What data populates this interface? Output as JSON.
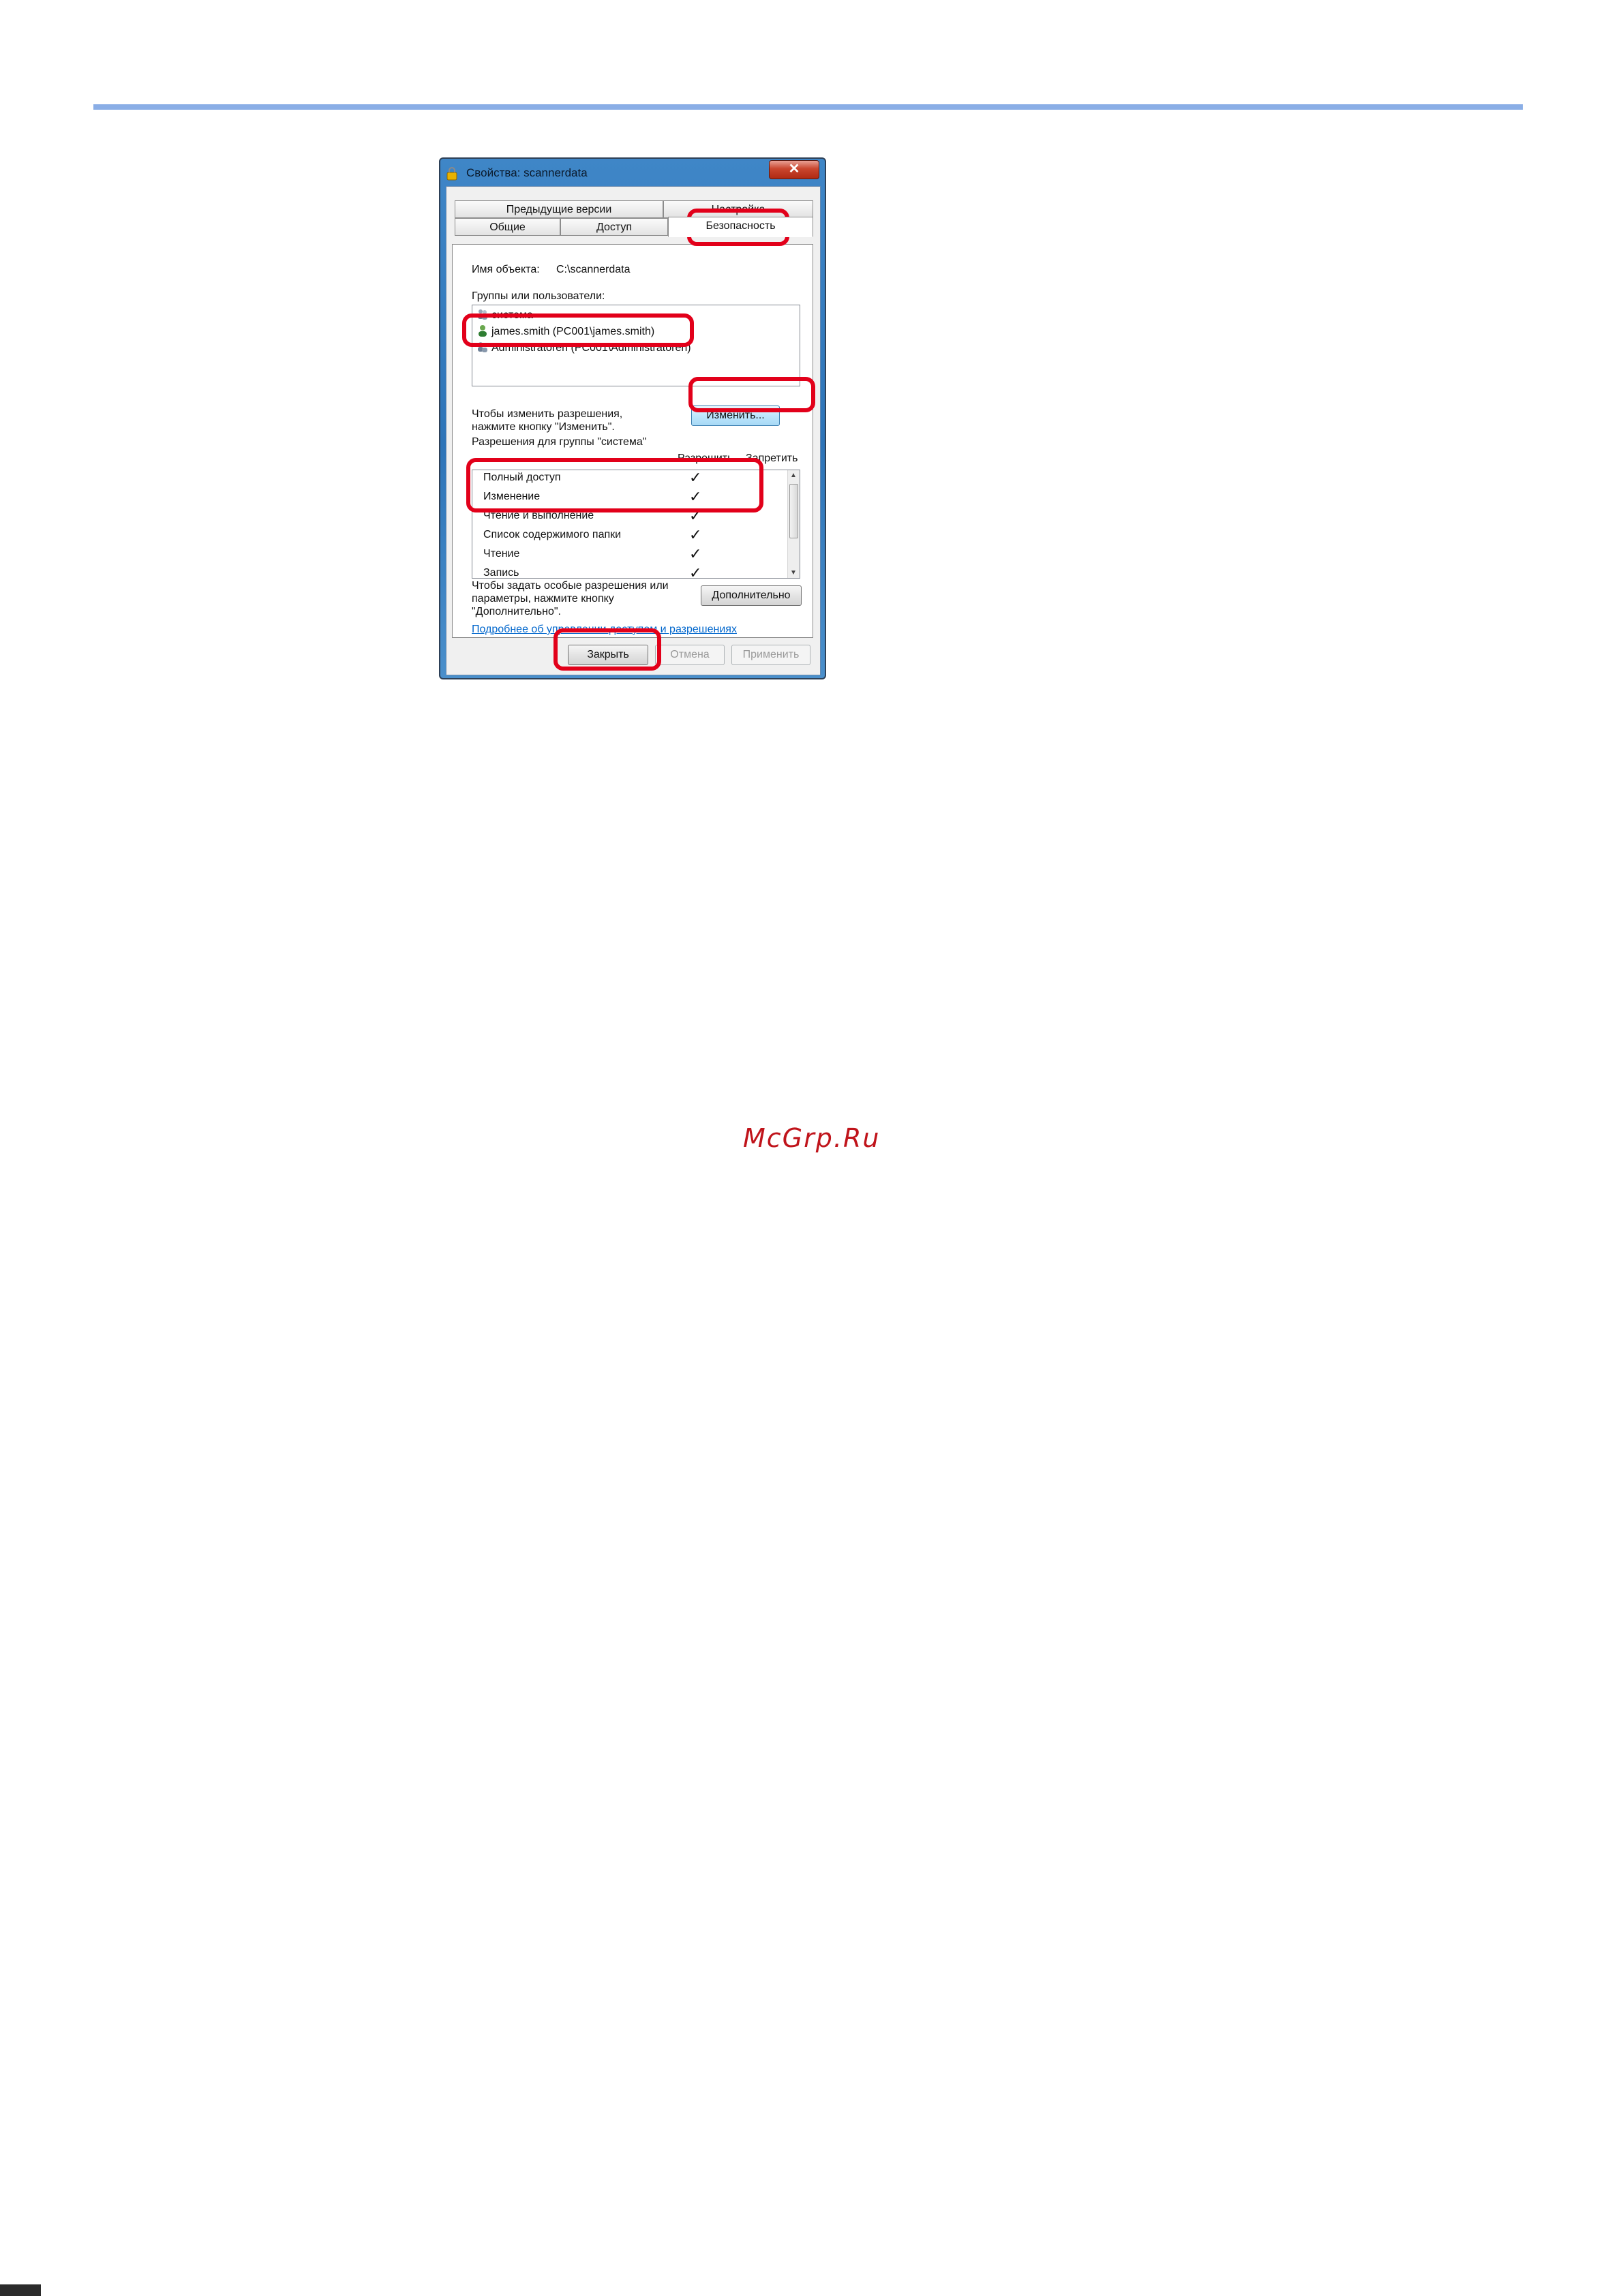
{
  "window": {
    "title": "Свойства: scannerdata",
    "close_glyph": "✕"
  },
  "tabs": {
    "row1": [
      "Предыдущие версии",
      "Настройка"
    ],
    "row2": [
      "Общие",
      "Доступ",
      "Безопасность"
    ],
    "active": "Безопасность"
  },
  "security": {
    "object_name_label": "Имя объекта:",
    "object_name_value": "C:\\scannerdata",
    "groups_label": "Группы или пользователи:",
    "groups": [
      "система",
      "james.smith (PC001\\james.smith)",
      "Administratoren (PC001\\Administratoren)"
    ],
    "change_hint_line1": "Чтобы изменить разрешения,",
    "change_hint_line2": "нажмите кнопку \"Изменить\".",
    "change_button": "Изменить...",
    "permissions_for_label": "Разрешения для группы \"система\"",
    "col_allow": "Разрешить",
    "col_deny": "Запретить",
    "permissions": [
      {
        "name": "Полный доступ",
        "allow": true,
        "deny": false
      },
      {
        "name": "Изменение",
        "allow": true,
        "deny": false
      },
      {
        "name": "Чтение и выполнение",
        "allow": true,
        "deny": false
      },
      {
        "name": "Список содержимого папки",
        "allow": true,
        "deny": false
      },
      {
        "name": "Чтение",
        "allow": true,
        "deny": false
      },
      {
        "name": "Запись",
        "allow": true,
        "deny": false
      }
    ],
    "check_glyph": "✓",
    "special_hint_line1": "Чтобы задать особые разрешения или",
    "special_hint_line2": "параметры, нажмите кнопку",
    "special_hint_line3": "\"Дополнительно\".",
    "advanced_button": "Дополнительно",
    "learn_more_link": "Подробнее об управлении доступом и разрешениях"
  },
  "footer_buttons": {
    "close": "Закрыть",
    "cancel": "Отмена",
    "apply": "Применить"
  },
  "watermark": "McGrp.Ru",
  "colors": {
    "highlight": "#e2001a",
    "rule": "#8aaee6",
    "link": "#0066cc"
  }
}
